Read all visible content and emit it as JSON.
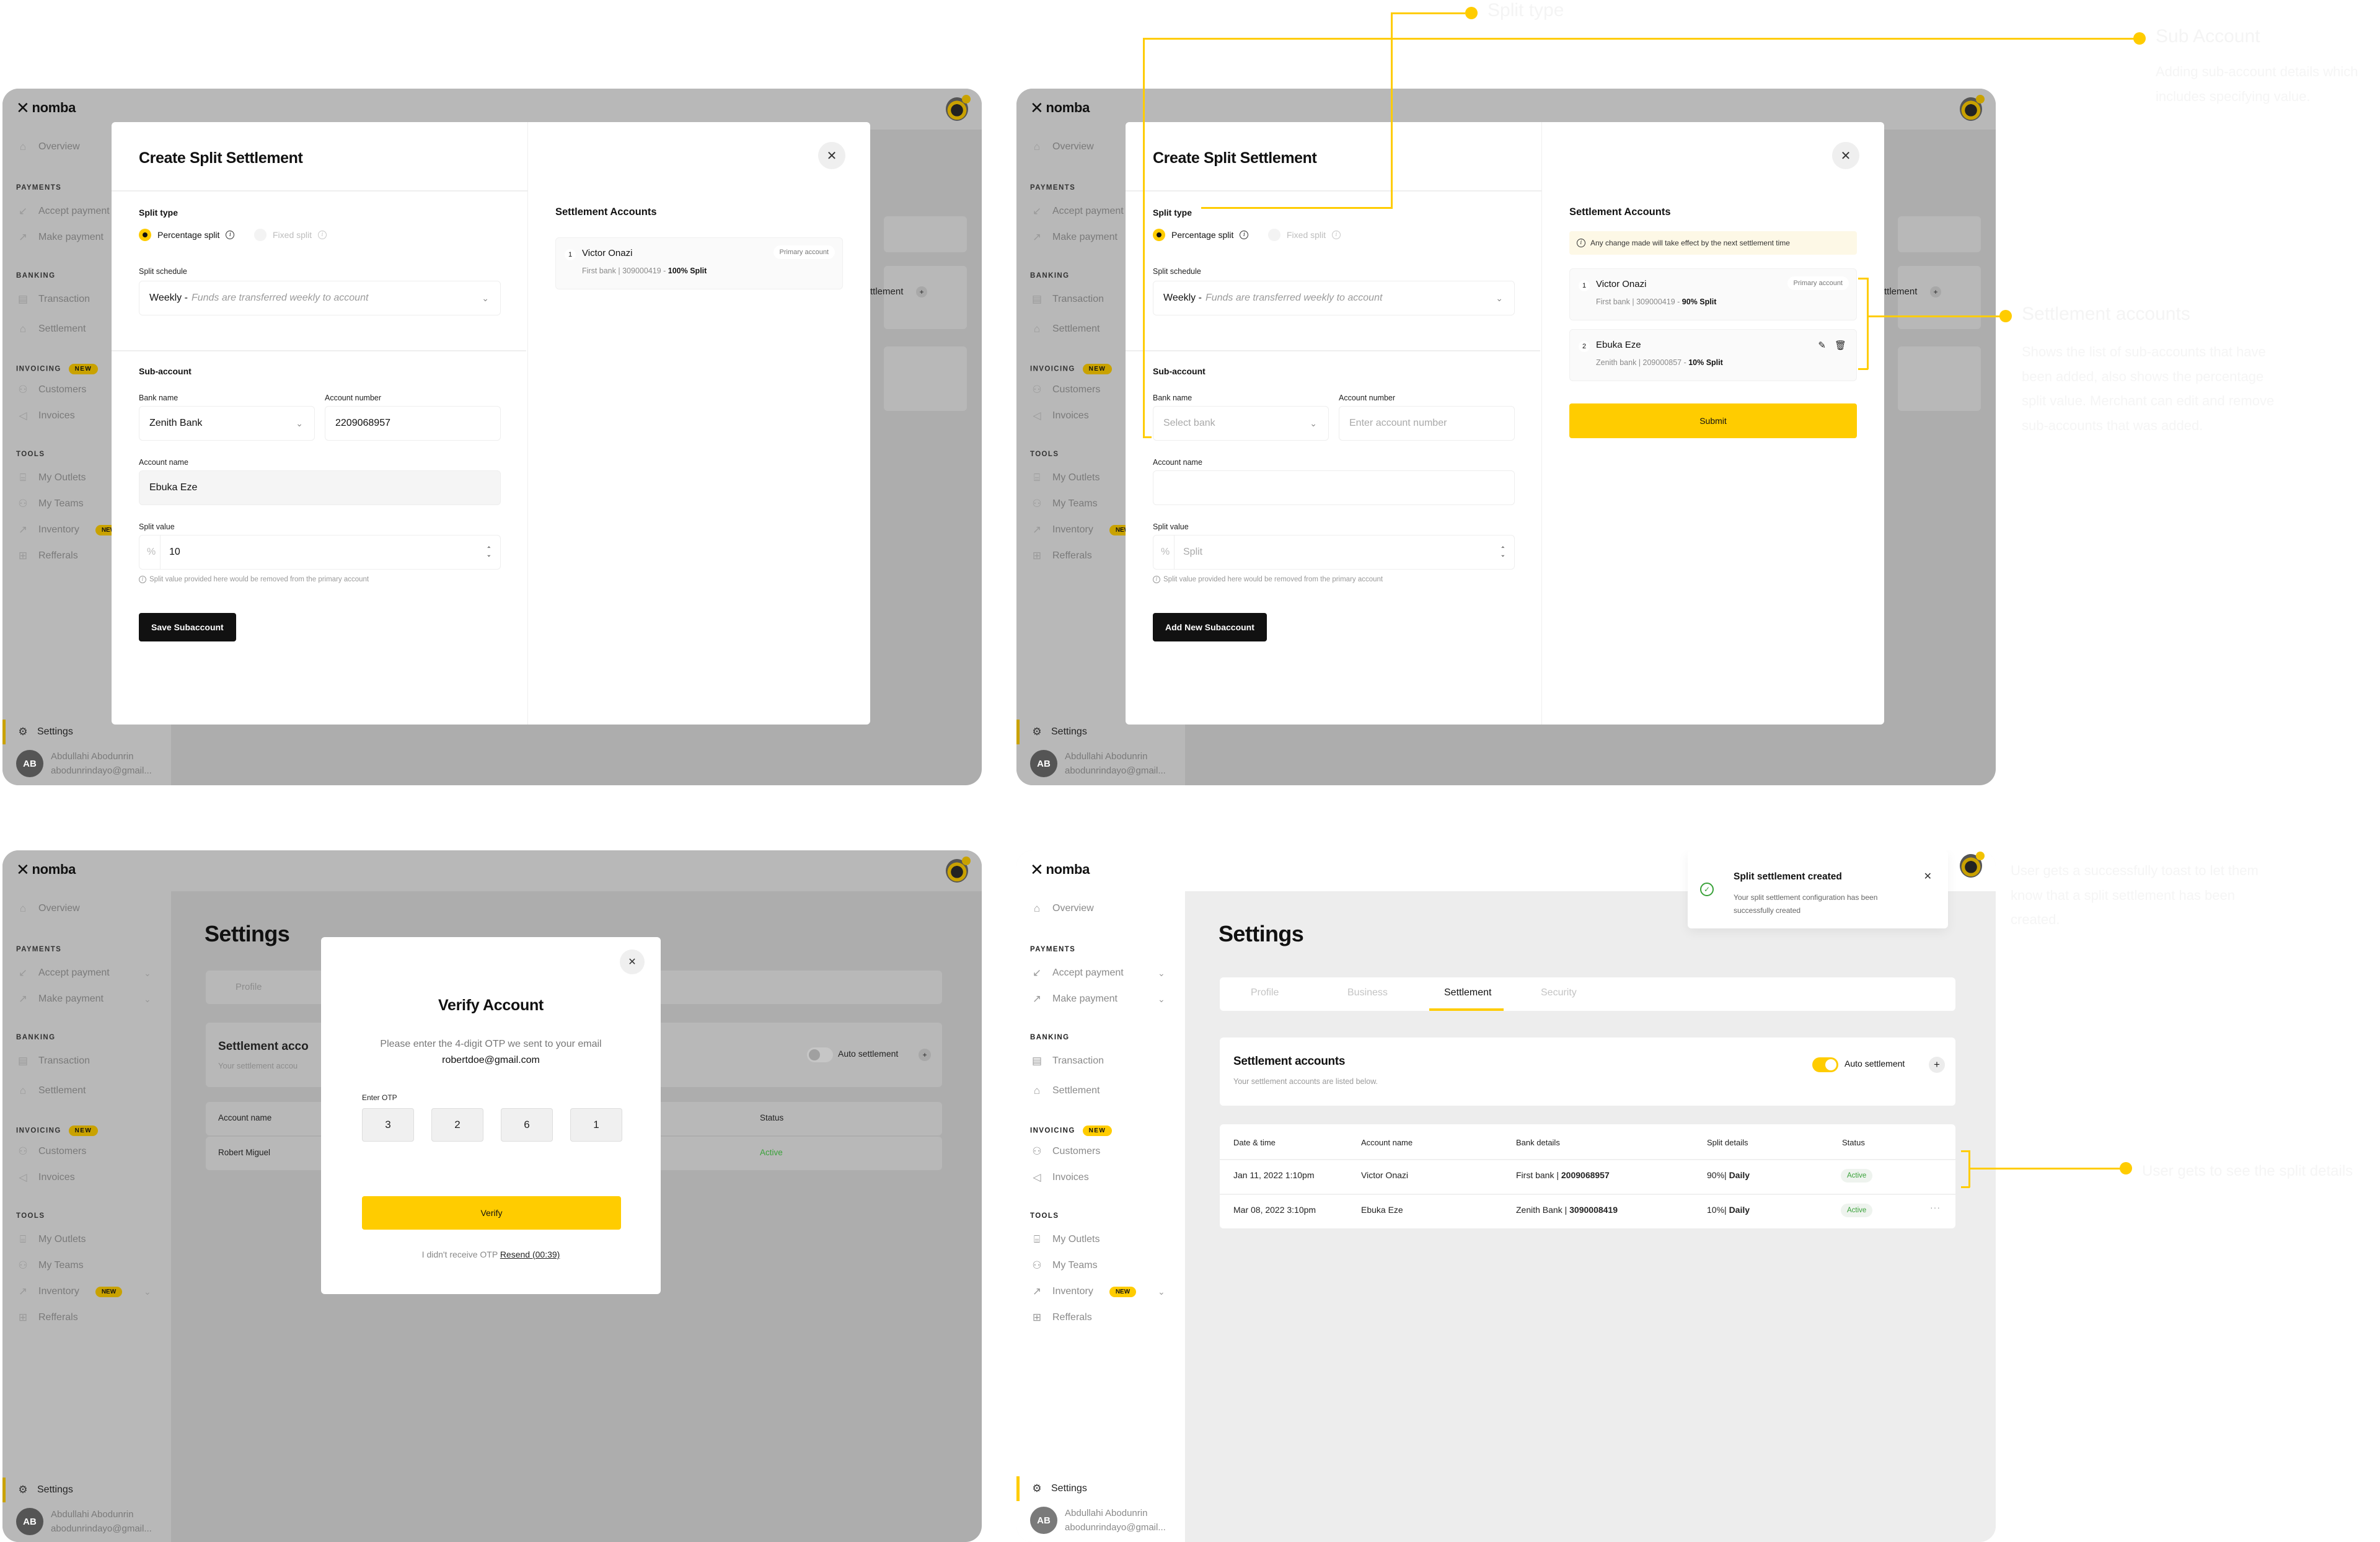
{
  "brand": {
    "name": "nomba",
    "accent": "#ffcc00"
  },
  "sidebar": {
    "overview": "Overview",
    "sections": {
      "payments": "PAYMENTS",
      "banking": "BANKING",
      "invoicing": "INVOICING",
      "tools": "TOOLS"
    },
    "items": {
      "accept_payment": "Accept payment",
      "make_payment": "Make payment",
      "transaction": "Transaction",
      "settlement": "Settlement",
      "customers": "Customers",
      "invoices": "Invoices",
      "my_outlets": "My Outlets",
      "my_teams": "My Teams",
      "inventory": "Inventory",
      "refferals": "Refferals"
    },
    "new_badge": "NEW",
    "settings": "Settings",
    "user": {
      "initials": "AB",
      "name": "Abdullahi Abodunrin",
      "email": "abodunrindayo@gmail..."
    }
  },
  "split_modal": {
    "title": "Create Split Settlement",
    "split_type_label": "Split type",
    "split_type_options": [
      "Percentage split",
      "Fixed split"
    ],
    "split_type_selected": "Percentage split",
    "split_schedule_label": "Split schedule",
    "split_schedule_value": "Weekly -",
    "split_schedule_desc": "Funds are transferred weekly to account",
    "subaccount_heading": "Sub-account",
    "bank_name_label": "Bank name",
    "account_number_label": "Account number",
    "account_name_label": "Account name",
    "split_value_label": "Split value",
    "percent_symbol": "%",
    "hint": "Split value provided here would be removed from the primary account",
    "settlement_accounts_title": "Settlement Accounts",
    "primary_account_label": "Primary account"
  },
  "screen_a": {
    "bank_name_value": "Zenith Bank",
    "account_number_value": "2209068957",
    "account_name_value": "Ebuka Eze",
    "split_value": "10",
    "save_button": "Save Subaccount",
    "accounts": [
      {
        "index": "1",
        "name": "Victor Onazi",
        "bank": "First bank",
        "number": "309000419",
        "split": "100% Split"
      }
    ],
    "bg_fragment": "ttlement"
  },
  "screen_b": {
    "bank_name_placeholder": "Select bank",
    "account_number_placeholder": "Enter account number",
    "account_name_value": "",
    "split_placeholder": "Split",
    "add_button": "Add New Subaccount",
    "notice": "Any change made will take effect by the next settlement time",
    "accounts": [
      {
        "index": "1",
        "name": "Victor Onazi",
        "bank": "First bank",
        "number": "309000419",
        "split": "90% Split",
        "primary": true
      },
      {
        "index": "2",
        "name": "Ebuka Eze",
        "bank": "Zenith bank",
        "number": "209000857",
        "split": "10% Split",
        "primary": false
      }
    ],
    "submit_button": "Submit",
    "bg_fragment": "ttlement"
  },
  "screen_c": {
    "page_title": "Settings",
    "bg_tab": "Profile",
    "bg_card_title": "Settlement acco",
    "bg_card_sub": "Your settlement accou",
    "bg_auto_settlement": "Auto settlement",
    "bg_col_account": "Account name",
    "bg_col_status": "Status",
    "bg_row_name": "Robert Miguel",
    "bg_row_status": "Active",
    "verify": {
      "title": "Verify Account",
      "desc": "Please enter the 4-digit OTP we sent to your email",
      "email": "robertdoe@gmail.com",
      "otp_label": "Enter OTP",
      "otp_digits": [
        "3",
        "2",
        "6",
        "1"
      ],
      "verify_button": "Verify",
      "resend_prefix": "I didn't receive OTP",
      "resend_link": "Resend (00:39)"
    }
  },
  "screen_d": {
    "page_title": "Settings",
    "tabs": [
      "Profile",
      "Business",
      "Settlement",
      "Security"
    ],
    "active_tab": "Settlement",
    "card_title": "Settlement accounts",
    "card_subtitle": "Your settlement accounts are listed below.",
    "auto_settlement_label": "Auto settlement",
    "auto_settlement_on": true,
    "table": {
      "columns": [
        "Date & time",
        "Account name",
        "Bank details",
        "Split details",
        "Status"
      ],
      "rows": [
        {
          "date": "Jan 11, 2022 1:10pm",
          "account": "Victor Onazi",
          "bank": "First bank",
          "number": "2009068957",
          "pct": "90%",
          "freq": "Daily",
          "status": "Active"
        },
        {
          "date": "Mar 08, 2022 3:10pm",
          "account": "Ebuka Eze",
          "bank": "Zenith Bank",
          "number": "3090008419",
          "pct": "10%",
          "freq": "Daily",
          "status": "Active"
        }
      ]
    },
    "toast": {
      "title": "Split settlement created",
      "body": "Your split settlement configuration has been successfully created"
    }
  },
  "annotations": {
    "split_type": "Split type",
    "sub_account": {
      "title": "Sub Account",
      "body": "Adding sub-account details which includes specifying value."
    },
    "settlement_accounts": {
      "title": "Settlement accounts",
      "body": "Shows the list of sub-accounts that have been added, also shows the percentage split value. Merchant can edit and remove sub-accounts that was added."
    },
    "toast": "User gets a successfully toast to let them know that a split settlement has been created.",
    "split_details": "User gets to see the split details"
  }
}
